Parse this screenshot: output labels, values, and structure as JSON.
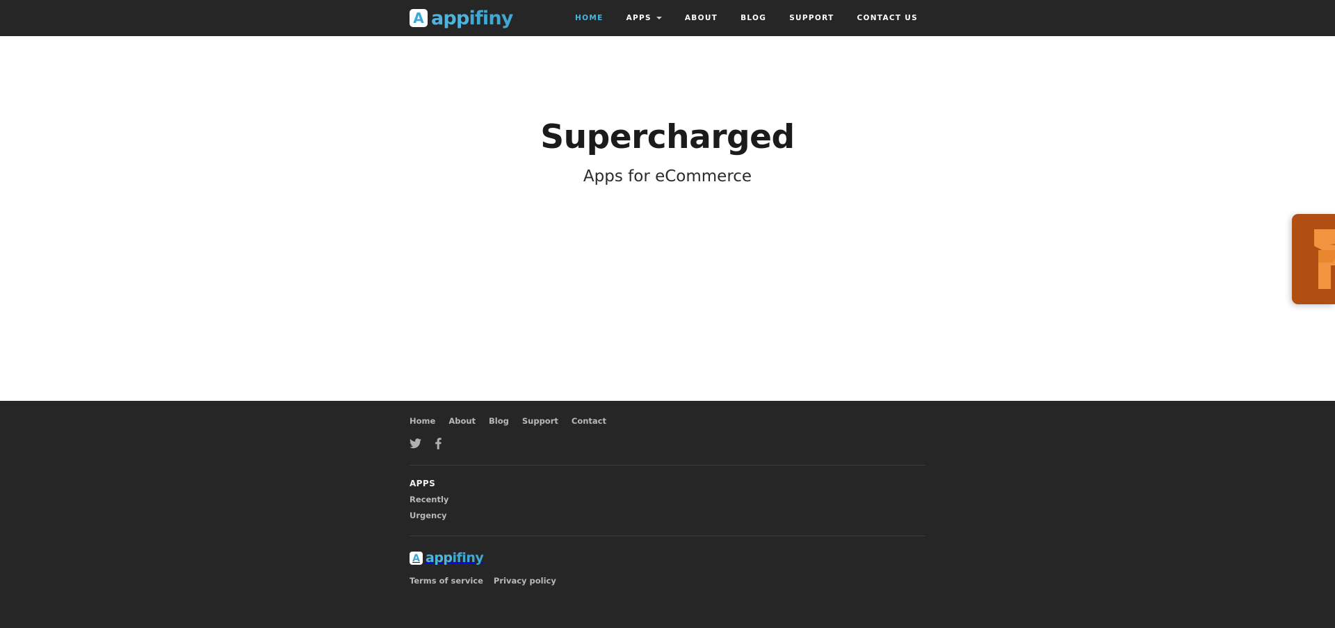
{
  "header": {
    "logo": {
      "mark_letter": "A",
      "text_light": "app",
      "text_bold": "ifiny",
      "alt": "appifiny"
    },
    "nav": [
      {
        "label": "HOME",
        "active": true
      },
      {
        "label": "APPS",
        "dropdown": true
      },
      {
        "label": "ABOUT"
      },
      {
        "label": "BLOG"
      },
      {
        "label": "SUPPORT"
      },
      {
        "label": "CONTACT US"
      }
    ]
  },
  "hero": {
    "title": "Supercharged",
    "subtitle": "Apps for eCommerce"
  },
  "side_tab": {
    "name": "feedback-tab",
    "color": "#b04e14",
    "icon_color": "#f29440"
  },
  "footer": {
    "nav": [
      {
        "label": "Home"
      },
      {
        "label": "About"
      },
      {
        "label": "Blog"
      },
      {
        "label": "Support"
      },
      {
        "label": "Contact"
      }
    ],
    "social": [
      {
        "name": "twitter",
        "label": "Twitter"
      },
      {
        "name": "facebook",
        "label": "Facebook"
      }
    ],
    "apps_heading": "APPS",
    "apps_links": [
      {
        "label": "Recently"
      },
      {
        "label": "Urgency"
      }
    ],
    "logo": {
      "mark_letter": "A",
      "text_light": "app",
      "text_bold": "ifiny"
    },
    "legal": [
      {
        "label": "Terms of service"
      },
      {
        "label": "Privacy policy"
      }
    ]
  },
  "colors": {
    "dark": "#262626",
    "accent_blue": "#45b6e0",
    "brand_blue": "#4fb4dd",
    "muted_text": "#b9b9b9",
    "divider": "#3d3d3d",
    "orange": "#b04e14"
  }
}
